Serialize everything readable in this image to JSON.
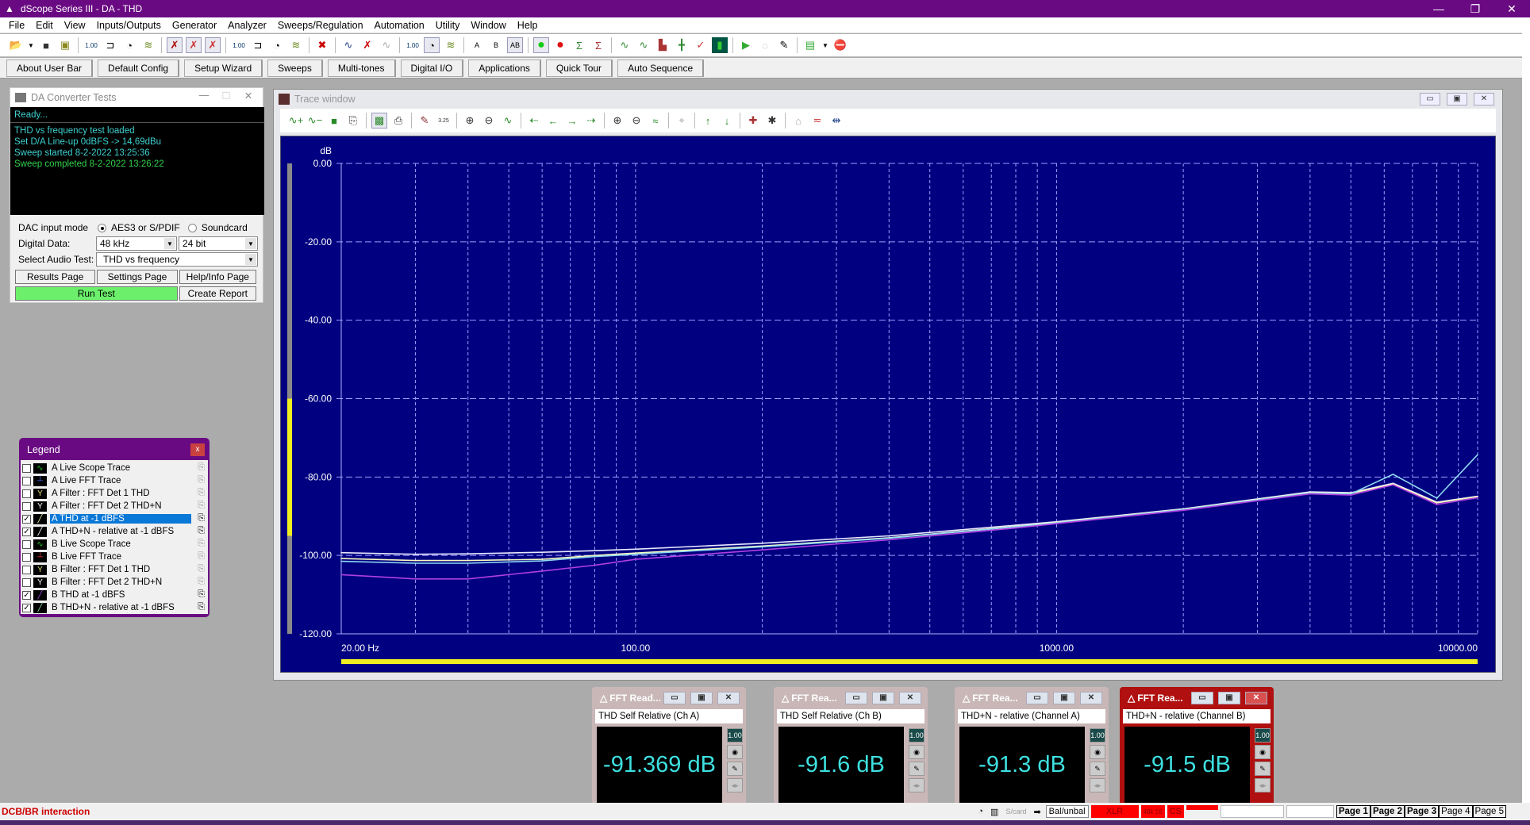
{
  "window": {
    "title": "dScope Series III - DA - THD",
    "minimize": "—",
    "restore": "❐",
    "close": "✕"
  },
  "menu": [
    "File",
    "Edit",
    "View",
    "Inputs/Outputs",
    "Generator",
    "Analyzer",
    "Sweeps/Regulation",
    "Automation",
    "Utility",
    "Window",
    "Help"
  ],
  "toolbar_icons": [
    "open-folder",
    "dropdown",
    "save",
    "save-as",
    "out-level-meter",
    "out-freq",
    "out-gauge",
    "out-spectrum",
    "out-level-disabled",
    "out-mute",
    "out-spectrum-disabled",
    "in-level-meter",
    "in-freq",
    "in-gauge",
    "in-spectrum",
    "stop-x",
    "wave-right",
    "wave-mute",
    "wave-disabled",
    "ac-level",
    "ac-gauge",
    "ac-spectrum",
    "ab-select-a",
    "ab-select-b",
    "ab-select-both",
    "go-green",
    "stop-red",
    "sweep-sigma",
    "fft-sigma",
    "trace-1",
    "trace-2",
    "spectrum-bars",
    "trace-marker",
    "trace-error",
    "scope-screen",
    "run-script",
    "script-disabled",
    "script-edit",
    "sequence-run",
    "dropdown",
    "sequence-stop"
  ],
  "userbar": [
    "About User Bar",
    "Default Config",
    "Setup Wizard",
    "Sweeps",
    "Multi-tones",
    "Digital I/O",
    "Applications",
    "Quick Tour",
    "Auto Sequence"
  ],
  "da_panel": {
    "title": "DA Converter Tests",
    "console": {
      "ready": "Ready...",
      "lines": [
        "THD vs frequency test loaded",
        "Set D/A Line-up 0dBFS -> 14,69dBu",
        "Sweep started 8-2-2022 13:25:36"
      ],
      "completed": "Sweep completed 8-2-2022 13:26:22"
    },
    "dac_input_mode_label": "DAC input mode",
    "mode_options": [
      "AES3 or S/PDIF",
      "Soundcard"
    ],
    "mode_selected": "AES3 or S/PDIF",
    "digital_data_label": "Digital Data:",
    "sample_rate": "48 kHz",
    "bit_depth": "24 bit",
    "select_test_label": "Select Audio Test:",
    "selected_test": "THD vs frequency",
    "buttons": {
      "results": "Results Page",
      "settings": "Settings Page",
      "help": "Help/Info Page",
      "run": "Run Test",
      "report": "Create Report"
    }
  },
  "legend": {
    "title": "Legend",
    "close": "x",
    "items": [
      {
        "label": "A Live Scope Trace",
        "checked": false,
        "icon": "scope",
        "color": "#2ec82e",
        "selected": false
      },
      {
        "label": "A Live FFT Trace",
        "checked": false,
        "icon": "fft",
        "color": "#3a6ae0",
        "selected": false
      },
      {
        "label": "A Filter : FFT Det 1 THD",
        "checked": false,
        "icon": "filter",
        "color": "#e8e070",
        "selected": false
      },
      {
        "label": "A Filter : FFT Det 2  THD+N",
        "checked": false,
        "icon": "filter",
        "color": "#ffffff",
        "selected": false
      },
      {
        "label": "A  THD  at -1 dBFS",
        "checked": true,
        "icon": "line",
        "color": "#f0f0a0",
        "selected": true
      },
      {
        "label": "A  THD+N - relative  at -1 dBFS",
        "checked": true,
        "icon": "line",
        "color": "#ffffff",
        "selected": false
      },
      {
        "label": "B Live Scope Trace",
        "checked": false,
        "icon": "scope",
        "color": "#2ec82e",
        "selected": false
      },
      {
        "label": "B Live FFT Trace",
        "checked": false,
        "icon": "fft",
        "color": "#e03030",
        "selected": false
      },
      {
        "label": "B Filter : FFT Det 1 THD",
        "checked": false,
        "icon": "filter",
        "color": "#e8e070",
        "selected": false
      },
      {
        "label": "B Filter : FFT Det 2 THD+N",
        "checked": false,
        "icon": "filter",
        "color": "#ffffff",
        "selected": false
      },
      {
        "label": "B  THD  at -1 dBFS",
        "checked": true,
        "icon": "line",
        "color": "#a040e0",
        "selected": false
      },
      {
        "label": "B  THD+N - relative  at -1 dBFS",
        "checked": true,
        "icon": "line",
        "color": "#80e0a0",
        "selected": false
      }
    ]
  },
  "trace_window": {
    "title": "Trace window"
  },
  "chart_data": {
    "type": "line",
    "title": "",
    "ylabel": "dB",
    "xlabel": "",
    "x_scale": "log",
    "xlim": [
      20,
      10000
    ],
    "ylim": [
      -120,
      0
    ],
    "grid": true,
    "yticks": [
      0,
      -20,
      -40,
      -60,
      -80,
      -100,
      -120
    ],
    "ytick_labels": [
      "0.00",
      "-20.00",
      "-40.00",
      "-60.00",
      "-80.00",
      "-100.00",
      "-120.00"
    ],
    "xtick_labels": [
      {
        "x": 20,
        "label": "20.00 Hz"
      },
      {
        "x": 100,
        "label": "100.00"
      },
      {
        "x": 1000,
        "label": "1000.00"
      },
      {
        "x": 10000,
        "label": "10000.00"
      }
    ],
    "x": [
      20,
      30,
      40,
      60,
      80,
      100,
      200,
      400,
      800,
      1000,
      2000,
      4000,
      5000,
      6300,
      8000,
      10000
    ],
    "series": [
      {
        "name": "A  THD+N - relative  at -1 dBFS",
        "color": "#e8e8ff",
        "values": [
          -99.3,
          -99.7,
          -99.6,
          -99.2,
          -98.8,
          -98.4,
          -96.9,
          -95.0,
          -92.3,
          -91.4,
          -88.1,
          -83.8,
          -84.0,
          -81.6,
          -86.4,
          -84.9
        ]
      },
      {
        "name": "A  THD  at -1 dBFS",
        "color": "#f8f8c0",
        "values": [
          -100.8,
          -101.3,
          -101.3,
          -101.0,
          -100.0,
          -99.4,
          -97.6,
          -95.5,
          -92.6,
          -91.6,
          -88.2,
          -84.0,
          -84.2,
          -81.8,
          -86.6,
          -85.0
        ]
      },
      {
        "name": "B  THD+N - relative  at -1 dBFS",
        "color": "#90d8f0",
        "values": [
          -101.5,
          -102.0,
          -102.0,
          -101.4,
          -100.3,
          -99.7,
          -97.8,
          -95.6,
          -92.7,
          -91.7,
          -88.3,
          -84.1,
          -84.3,
          -79.3,
          -85.4,
          -74.3
        ]
      },
      {
        "name": "B  THD  at -1 dBFS",
        "color": "#b040e0",
        "values": [
          -104.9,
          -106.0,
          -106.0,
          -104.0,
          -102.5,
          -101.0,
          -98.6,
          -96.0,
          -93.0,
          -91.9,
          -88.5,
          -84.3,
          -84.6,
          -82.0,
          -87.0,
          -85.3
        ]
      }
    ]
  },
  "fft_readers": [
    {
      "title": "FFT Read...",
      "subtitle": "THD Self Relative (Ch A)",
      "value": "-91.369 dB",
      "active": false
    },
    {
      "title": "FFT Rea...",
      "subtitle": "THD Self Relative (Ch B)",
      "value": "-91.6 dB",
      "active": false
    },
    {
      "title": "FFT Rea...",
      "subtitle": "THD+N - relative (Channel A)",
      "value": "-91.3 dB",
      "active": false
    },
    {
      "title": "FFT Rea...",
      "subtitle": "THD+N - relative (Channel B)",
      "value": "-91.5 dB",
      "active": true
    }
  ],
  "statusbar": {
    "message": "DCB/BR interaction",
    "scard": "S/card",
    "balunbal": "Bal/unbal",
    "xlr": "XLR",
    "rate": "48k 16",
    "cs": "CS",
    "pages": [
      "Page 1",
      "Page 2",
      "Page 3",
      "Page 4",
      "Page 5"
    ]
  }
}
